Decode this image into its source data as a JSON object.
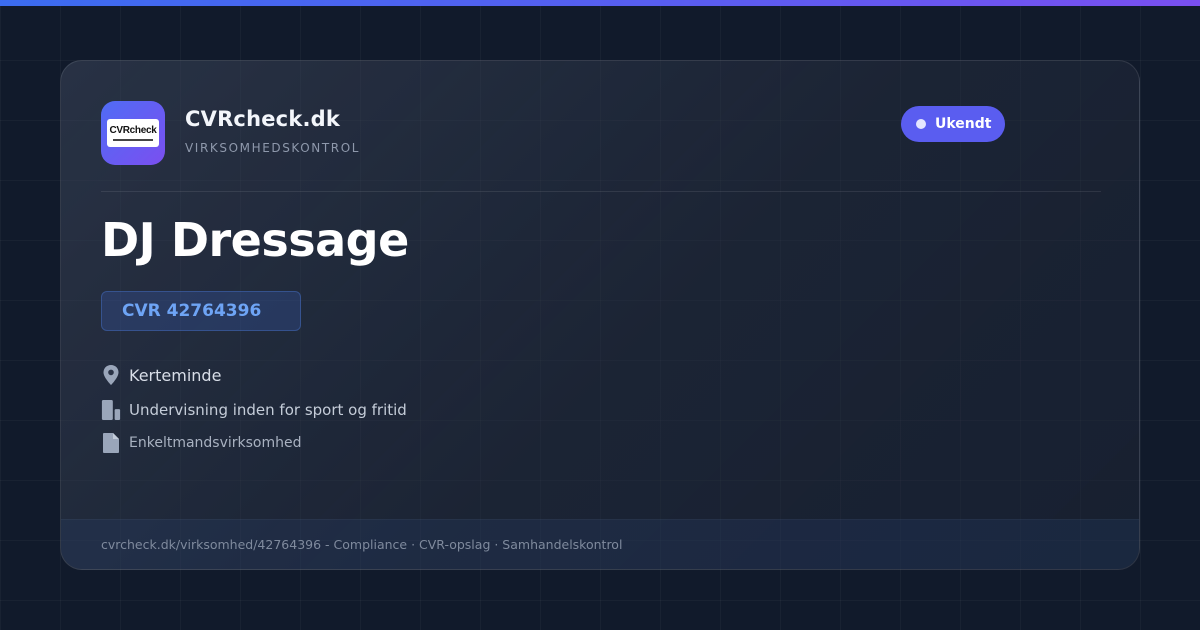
{
  "brand": {
    "name": "CVRcheck.dk",
    "subtitle": "VIRKSOMHEDSKONTROL",
    "logo_text": "CVRcheck",
    "accent_colors": [
      "#4f6cf5",
      "#7b4ff0"
    ]
  },
  "status": {
    "label": "Ukendt",
    "color": "#5a5df0"
  },
  "company": {
    "name": "DJ Dressage",
    "cvr": "CVR 42764396"
  },
  "details": {
    "location": "Kerteminde",
    "industry": "Undervisning inden for sport og fritid",
    "company_type": "Enkeltmandsvirksomhed"
  },
  "icons": {
    "location": "map-pin-icon",
    "industry": "building-icon",
    "company_type": "document-icon"
  },
  "footer": {
    "text": "cvrcheck.dk/virksomhed/42764396 - Compliance · CVR-opslag · Samhandelskontrol"
  }
}
